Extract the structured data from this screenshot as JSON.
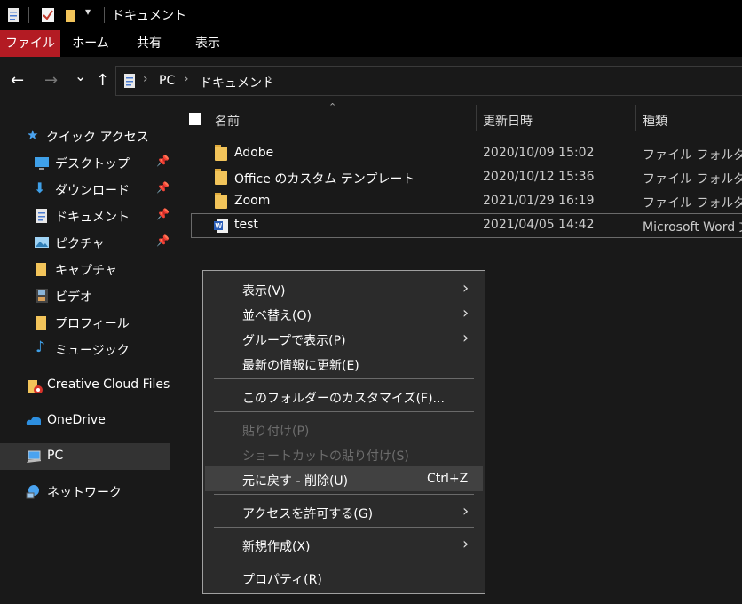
{
  "window": {
    "title": "ドキュメント"
  },
  "ribbon": {
    "tabs": [
      "ファイル",
      "ホーム",
      "共有",
      "表示"
    ]
  },
  "nav": {
    "back": "←",
    "forward": "→",
    "recent": "⌄",
    "up": "↑",
    "breadcrumb": [
      "PC",
      "ドキュメント"
    ]
  },
  "sidebar": {
    "items": [
      {
        "label": "クイック アクセス",
        "icon": "star-icon"
      },
      {
        "label": "デスクトップ",
        "icon": "desktop-icon",
        "pinned": true
      },
      {
        "label": "ダウンロード",
        "icon": "download-icon",
        "pinned": true
      },
      {
        "label": "ドキュメント",
        "icon": "document-icon",
        "pinned": true
      },
      {
        "label": "ピクチャ",
        "icon": "pictures-icon",
        "pinned": true
      },
      {
        "label": "キャプチャ",
        "icon": "folder-icon"
      },
      {
        "label": "ビデオ",
        "icon": "video-icon"
      },
      {
        "label": "プロフィール",
        "icon": "folder-icon"
      },
      {
        "label": "ミュージック",
        "icon": "music-icon"
      },
      {
        "label": "Creative Cloud Files",
        "icon": "creative-cloud-icon"
      },
      {
        "label": "OneDrive",
        "icon": "cloud-icon"
      },
      {
        "label": "PC",
        "icon": "computer-icon",
        "selected": true
      },
      {
        "label": "ネットワーク",
        "icon": "network-icon"
      }
    ]
  },
  "filelist": {
    "columns": {
      "name": "名前",
      "date": "更新日時",
      "type": "種類"
    },
    "rows": [
      {
        "name": "Adobe",
        "date": "2020/10/09 15:02",
        "type": "ファイル フォルダー",
        "icon": "folder-icon"
      },
      {
        "name": "Office のカスタム テンプレート",
        "date": "2020/10/12 15:36",
        "type": "ファイル フォルダー",
        "icon": "folder-icon"
      },
      {
        "name": "Zoom",
        "date": "2021/01/29 16:19",
        "type": "ファイル フォルダー",
        "icon": "folder-icon"
      },
      {
        "name": "test",
        "date": "2021/04/05 14:42",
        "type": "Microsoft Word 文",
        "icon": "word-document-icon"
      }
    ]
  },
  "context_menu": {
    "items": [
      {
        "label": "表示(V)",
        "submenu": true
      },
      {
        "label": "並べ替え(O)",
        "submenu": true
      },
      {
        "label": "グループで表示(P)",
        "submenu": true
      },
      {
        "label": "最新の情報に更新(E)"
      },
      {
        "label": "このフォルダーのカスタマイズ(F)..."
      },
      {
        "label": "貼り付け(P)",
        "disabled": true
      },
      {
        "label": "ショートカットの貼り付け(S)",
        "disabled": true
      },
      {
        "label": "元に戻す - 削除(U)",
        "shortcut": "Ctrl+Z",
        "highlighted": true
      },
      {
        "label": "アクセスを許可する(G)",
        "submenu": true
      },
      {
        "label": "新規作成(X)",
        "submenu": true
      },
      {
        "label": "プロパティ(R)"
      }
    ]
  },
  "colors": {
    "background": "#191919",
    "file_tab": "#b31b23",
    "menu_bg": "#2b2b2b",
    "menu_highlight": "#414141",
    "folder": "#f2c45a"
  }
}
